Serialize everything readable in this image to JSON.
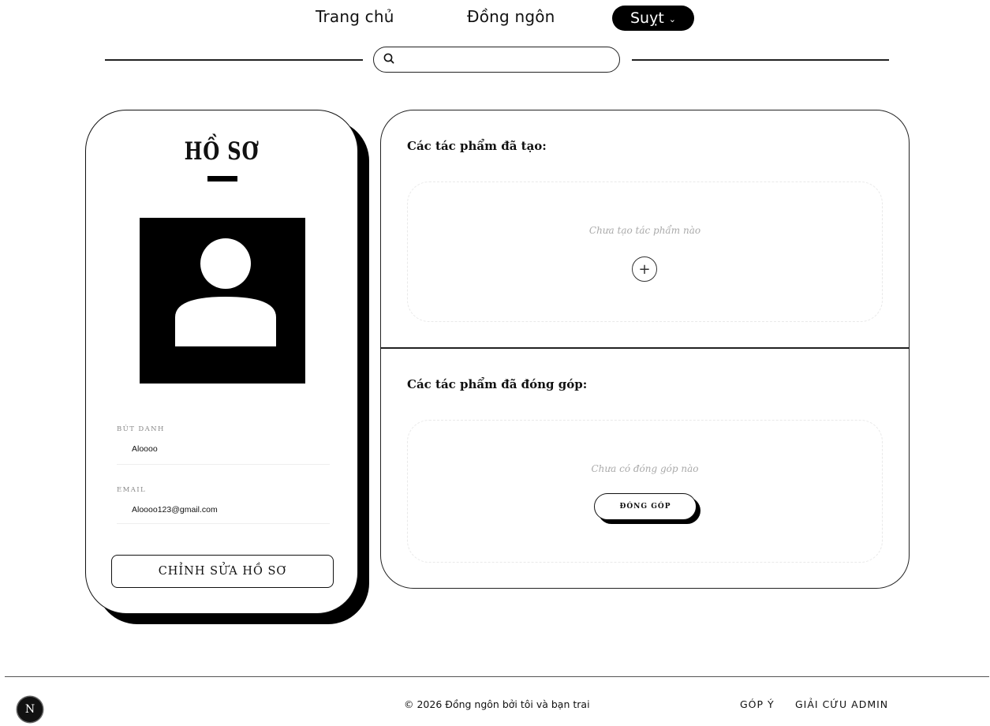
{
  "nav": {
    "home_label": "Trang chủ",
    "dongngon_label": "Đồng ngôn",
    "user_label": "Suỵt",
    "user_chevron": "⌄"
  },
  "search": {
    "placeholder": "",
    "value": ""
  },
  "profile": {
    "title": "HỒ SƠ",
    "pen_name_label": "BÚT DANH",
    "pen_name_value": "Aloooo",
    "email_label": "EMAIL",
    "email_value": "Aloooo123@gmail.com",
    "edit_button_label": "CHỈNH SỬA HỒ SƠ"
  },
  "works": {
    "created_title": "Các tác phẩm đã tạo:",
    "created_empty_text": "Chưa tạo tác phẩm nào",
    "add_icon_glyph": "+",
    "contributed_title": "Các tác phẩm đã đóng góp:",
    "contributed_empty_text": "Chưa có đóng góp nào",
    "contribute_button_label": "ĐÓNG GÓP"
  },
  "footer": {
    "badge_letter": "N",
    "copyright": "© 2026 Đồng ngôn bởi tôi và bạn trai",
    "feedback_label": "GÓP Ý",
    "rescue_admin_label": "GIẢI CỨU ADMIN"
  },
  "colors": {
    "ink": "#000000",
    "paper": "#ffffff",
    "muted": "#aaaaaa",
    "dashed": "#e9e9e9"
  },
  "icons": [
    "search-icon",
    "chevron-down-icon",
    "user-silhouette-icon",
    "plus-icon",
    "next-logo-icon"
  ]
}
